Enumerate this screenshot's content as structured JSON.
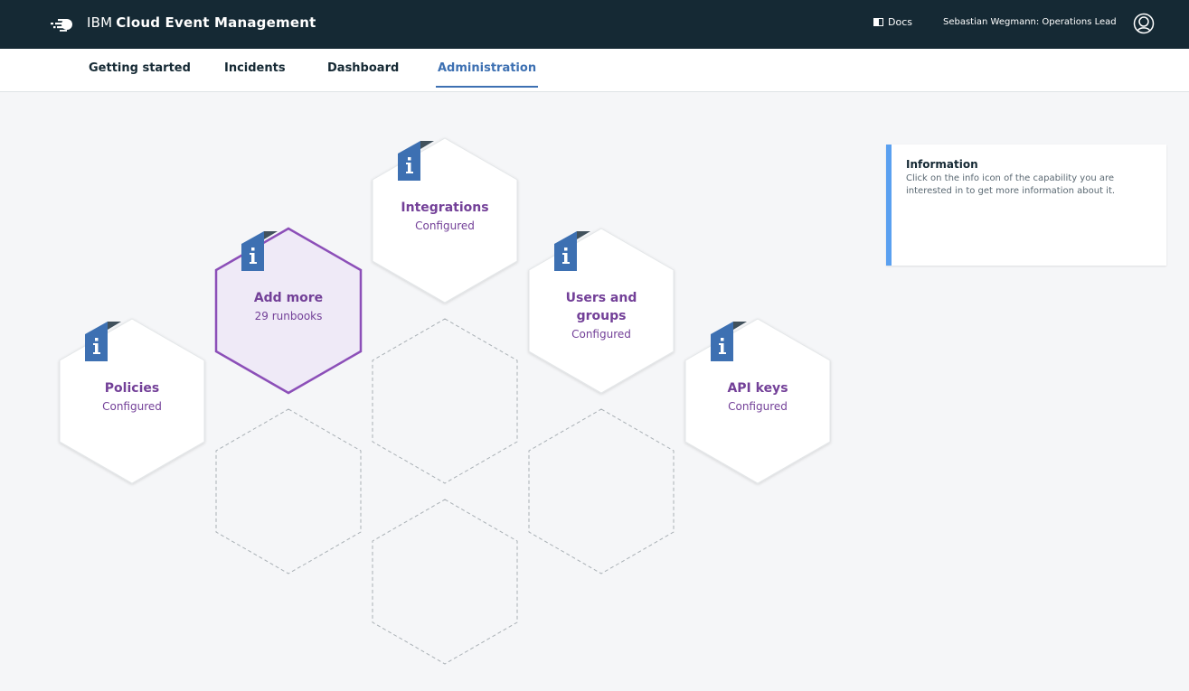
{
  "header": {
    "brand": "IBM",
    "product": "Cloud Event Management",
    "docs_label": "Docs",
    "user": "Sebastian Wegmann: Operations Lead",
    "icons": {
      "logo": "cloud-event-logo",
      "docs": "docs-panel-icon",
      "user": "user-avatar-icon"
    }
  },
  "nav": {
    "tabs": [
      {
        "label": "Getting started"
      },
      {
        "label": "Incidents"
      },
      {
        "label": "Dashboard"
      },
      {
        "label": "Administration",
        "active": true
      }
    ]
  },
  "capabilities": [
    {
      "title": "Policies",
      "status": "Configured"
    },
    {
      "title": "Add more",
      "status": "29 runbooks",
      "highlighted": true
    },
    {
      "title": "Integrations",
      "status": "Configured"
    },
    {
      "title": "Users and groups",
      "status": "Configured"
    },
    {
      "title": "API keys",
      "status": "Configured"
    }
  ],
  "info_panel": {
    "title": "Information",
    "text": "Click on the info icon of the capability you are interested in to get more information about it."
  },
  "colors": {
    "header_bg": "#152934",
    "accent_blue": "#3d70b2",
    "capability_purple": "#734098",
    "highlight_fill": "#efeaf7",
    "info_border": "#5aa0f0"
  }
}
